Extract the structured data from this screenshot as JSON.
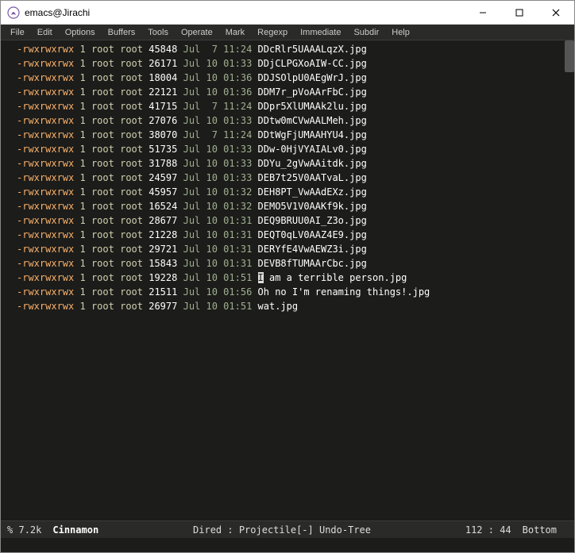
{
  "window": {
    "title": "emacs@Jirachi",
    "min_label": "—",
    "max_label": "☐",
    "close_label": "✕"
  },
  "menu": {
    "items": [
      "File",
      "Edit",
      "Options",
      "Buffers",
      "Tools",
      "Operate",
      "Mark",
      "Regexp",
      "Immediate",
      "Subdir",
      "Help"
    ]
  },
  "listing": {
    "rows": [
      {
        "perm": "-rwxrwxrwx",
        "links": "1",
        "owner": "root",
        "group": "root",
        "size": "45848",
        "date": "Jul  7 11:24",
        "name": "DDcRlr5UAAALqzX.jpg"
      },
      {
        "perm": "-rwxrwxrwx",
        "links": "1",
        "owner": "root",
        "group": "root",
        "size": "26171",
        "date": "Jul 10 01:33",
        "name": "DDjCLPGXoAIW-CC.jpg"
      },
      {
        "perm": "-rwxrwxrwx",
        "links": "1",
        "owner": "root",
        "group": "root",
        "size": "18004",
        "date": "Jul 10 01:36",
        "name": "DDJSOlpU0AEgWrJ.jpg"
      },
      {
        "perm": "-rwxrwxrwx",
        "links": "1",
        "owner": "root",
        "group": "root",
        "size": "22121",
        "date": "Jul 10 01:36",
        "name": "DDM7r_pVoAArFbC.jpg"
      },
      {
        "perm": "-rwxrwxrwx",
        "links": "1",
        "owner": "root",
        "group": "root",
        "size": "41715",
        "date": "Jul  7 11:24",
        "name": "DDpr5XlUMAAk2lu.jpg"
      },
      {
        "perm": "-rwxrwxrwx",
        "links": "1",
        "owner": "root",
        "group": "root",
        "size": "27076",
        "date": "Jul 10 01:33",
        "name": "DDtw0mCVwAALMeh.jpg"
      },
      {
        "perm": "-rwxrwxrwx",
        "links": "1",
        "owner": "root",
        "group": "root",
        "size": "38070",
        "date": "Jul  7 11:24",
        "name": "DDtWgFjUMAAHYU4.jpg"
      },
      {
        "perm": "-rwxrwxrwx",
        "links": "1",
        "owner": "root",
        "group": "root",
        "size": "51735",
        "date": "Jul 10 01:33",
        "name": "DDw-0HjVYAIALv0.jpg"
      },
      {
        "perm": "-rwxrwxrwx",
        "links": "1",
        "owner": "root",
        "group": "root",
        "size": "31788",
        "date": "Jul 10 01:33",
        "name": "DDYu_2gVwAAitdk.jpg"
      },
      {
        "perm": "-rwxrwxrwx",
        "links": "1",
        "owner": "root",
        "group": "root",
        "size": "24597",
        "date": "Jul 10 01:33",
        "name": "DEB7t25V0AATvaL.jpg"
      },
      {
        "perm": "-rwxrwxrwx",
        "links": "1",
        "owner": "root",
        "group": "root",
        "size": "45957",
        "date": "Jul 10 01:32",
        "name": "DEH8PT_VwAAdEXz.jpg"
      },
      {
        "perm": "-rwxrwxrwx",
        "links": "1",
        "owner": "root",
        "group": "root",
        "size": "16524",
        "date": "Jul 10 01:32",
        "name": "DEMO5V1V0AAKf9k.jpg"
      },
      {
        "perm": "-rwxrwxrwx",
        "links": "1",
        "owner": "root",
        "group": "root",
        "size": "28677",
        "date": "Jul 10 01:31",
        "name": "DEQ9BRUU0AI_Z3o.jpg"
      },
      {
        "perm": "-rwxrwxrwx",
        "links": "1",
        "owner": "root",
        "group": "root",
        "size": "21228",
        "date": "Jul 10 01:31",
        "name": "DEQT0qLV0AAZ4E9.jpg"
      },
      {
        "perm": "-rwxrwxrwx",
        "links": "1",
        "owner": "root",
        "group": "root",
        "size": "29721",
        "date": "Jul 10 01:31",
        "name": "DERYfE4VwAEWZ3i.jpg"
      },
      {
        "perm": "-rwxrwxrwx",
        "links": "1",
        "owner": "root",
        "group": "root",
        "size": "15843",
        "date": "Jul 10 01:31",
        "name": "DEVB8fTUMAArCbc.jpg"
      },
      {
        "perm": "-rwxrwxrwx",
        "links": "1",
        "owner": "root",
        "group": "root",
        "size": "19228",
        "date": "Jul 10 01:51",
        "name": "I am a terrible person.jpg",
        "cursor_at": 0
      },
      {
        "perm": "-rwxrwxrwx",
        "links": "1",
        "owner": "root",
        "group": "root",
        "size": "21511",
        "date": "Jul 10 01:56",
        "name": "Oh no I'm renaming things!.jpg"
      },
      {
        "perm": "-rwxrwxrwx",
        "links": "1",
        "owner": "root",
        "group": "root",
        "size": "26977",
        "date": "Jul 10 01:51",
        "name": "wat.jpg"
      }
    ]
  },
  "modeline": {
    "modified": "%",
    "size": "7.2k",
    "buffer": "Cinnamon",
    "modes": "Dired : Projectile[-] Undo-Tree",
    "position": "112 : 44",
    "scroll": "Bottom"
  }
}
